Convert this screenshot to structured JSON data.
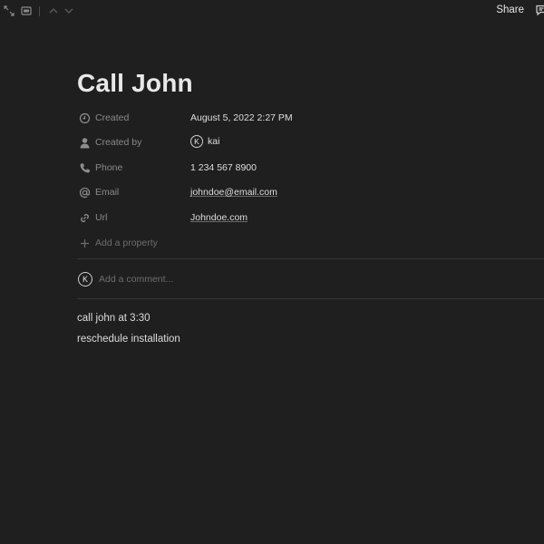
{
  "topbar": {
    "icons": [
      "expand-icon",
      "sidebar-peek-icon",
      "chevron-up-icon",
      "chevron-down-icon"
    ],
    "share_label": "Share",
    "comment_icon": "comment-icon"
  },
  "page": {
    "title": "Call John",
    "properties": [
      {
        "icon": "clock-icon",
        "label": "Created",
        "value": "August 5, 2022 2:27 PM"
      },
      {
        "icon": "person-icon",
        "label": "Created by",
        "value": "kai",
        "avatar": "K"
      },
      {
        "icon": "phone-icon",
        "label": "Phone",
        "value": "1 234 567 8900"
      },
      {
        "icon": "at-icon",
        "label": "Email",
        "value": "johndoe@email.com"
      },
      {
        "icon": "link-icon",
        "label": "Url",
        "value": "Johndoe.com"
      }
    ],
    "add_property_label": "Add a property",
    "comment": {
      "avatar": "K",
      "placeholder": "Add a comment..."
    },
    "body": [
      "call john at 3:30",
      "reschedule installation"
    ]
  }
}
